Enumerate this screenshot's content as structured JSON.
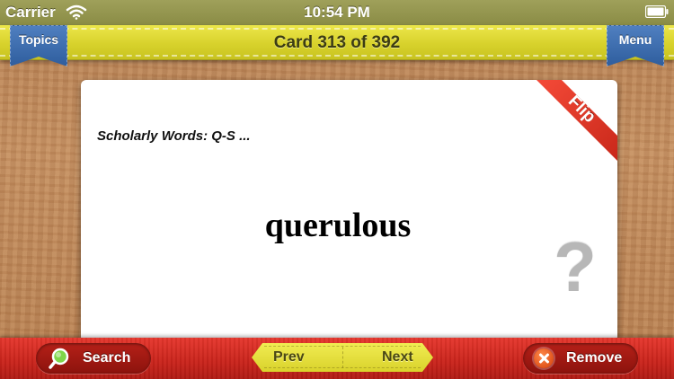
{
  "status_bar": {
    "carrier": "Carrier",
    "time": "10:54 PM",
    "wifi_icon": "wifi-icon",
    "battery_icon": "battery-icon"
  },
  "nav_bar": {
    "title": "Card 313 of 392",
    "left_button": "Topics",
    "right_button": "Menu"
  },
  "card": {
    "topic": "Scholarly Words: Q-S ...",
    "word": "querulous",
    "flip_label": "Flip",
    "hint_glyph": "?"
  },
  "toolbar": {
    "search_label": "Search",
    "prev_label": "Prev",
    "next_label": "Next",
    "remove_label": "Remove"
  },
  "colors": {
    "nav_yellow": "#d8d22c",
    "ribbon_blue": "#2f5e9e",
    "toolbar_red": "#c9231b",
    "flip_red": "#e0392a"
  }
}
